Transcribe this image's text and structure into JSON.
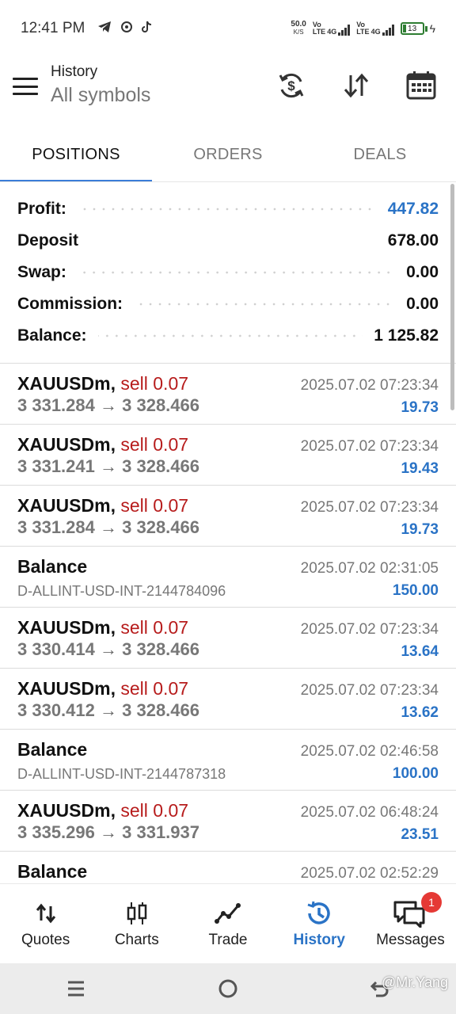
{
  "status_bar": {
    "time": "12:41 PM",
    "net_speed": "50.0",
    "net_unit": "K/S",
    "sim1_label_top": "Vo",
    "sim1_label_bottom": "LTE",
    "sim1_tech": "4G",
    "sim2_label_top": "Vo",
    "sim2_label_bottom": "LTE",
    "sim2_tech": "4G",
    "battery": "13",
    "icons": [
      "telegram-icon",
      "app-icon",
      "tiktok-icon"
    ]
  },
  "header": {
    "title": "History",
    "subtitle": "All symbols",
    "icons": [
      "currency-sync-icon",
      "sort-icon",
      "calendar-icon"
    ]
  },
  "tabs": [
    {
      "label": "POSITIONS",
      "active": true
    },
    {
      "label": "ORDERS",
      "active": false
    },
    {
      "label": "DEALS",
      "active": false
    }
  ],
  "summary": [
    {
      "label": "Profit:",
      "value": "447.82",
      "dots": true,
      "highlight": true
    },
    {
      "label": "Deposit",
      "value": "678.00",
      "dots": false,
      "highlight": false
    },
    {
      "label": "Swap:",
      "value": "0.00",
      "dots": true,
      "highlight": false
    },
    {
      "label": "Commission:",
      "value": "0.00",
      "dots": true,
      "highlight": false
    },
    {
      "label": "Balance:",
      "value": "1 125.82",
      "dots": true,
      "highlight": false
    }
  ],
  "history": [
    {
      "type": "trade",
      "symbol": "XAUUSDm,",
      "side": "sell 0.07",
      "open": "3 331.284",
      "arrow": "→",
      "close": "3 328.466",
      "time": "2025.07.02 07:23:34",
      "profit": "19.73"
    },
    {
      "type": "trade",
      "symbol": "XAUUSDm,",
      "side": "sell 0.07",
      "open": "3 331.241",
      "arrow": "→",
      "close": "3 328.466",
      "time": "2025.07.02 07:23:34",
      "profit": "19.43"
    },
    {
      "type": "trade",
      "symbol": "XAUUSDm,",
      "side": "sell 0.07",
      "open": "3 331.284",
      "arrow": "→",
      "close": "3 328.466",
      "time": "2025.07.02 07:23:34",
      "profit": "19.73"
    },
    {
      "type": "balance",
      "title": "Balance",
      "desc": "D-ALLINT-USD-INT-2144784096",
      "time": "2025.07.02 02:31:05",
      "profit": "150.00"
    },
    {
      "type": "trade",
      "symbol": "XAUUSDm,",
      "side": "sell 0.07",
      "open": "3 330.414",
      "arrow": "→",
      "close": "3 328.466",
      "time": "2025.07.02 07:23:34",
      "profit": "13.64"
    },
    {
      "type": "trade",
      "symbol": "XAUUSDm,",
      "side": "sell 0.07",
      "open": "3 330.412",
      "arrow": "→",
      "close": "3 328.466",
      "time": "2025.07.02 07:23:34",
      "profit": "13.62"
    },
    {
      "type": "balance",
      "title": "Balance",
      "desc": "D-ALLINT-USD-INT-2144787318",
      "time": "2025.07.02 02:46:58",
      "profit": "100.00"
    },
    {
      "type": "trade",
      "symbol": "XAUUSDm,",
      "side": "sell 0.07",
      "open": "3 335.296",
      "arrow": "→",
      "close": "3 331.937",
      "time": "2025.07.02 06:48:24",
      "profit": "23.51"
    },
    {
      "type": "balance",
      "title": "Balance",
      "desc": "",
      "time": "2025.07.02 02:52:29",
      "profit": ""
    }
  ],
  "bottom_nav": [
    {
      "label": "Quotes",
      "icon": "quotes-icon",
      "active": false
    },
    {
      "label": "Charts",
      "icon": "charts-icon",
      "active": false
    },
    {
      "label": "Trade",
      "icon": "trade-icon",
      "active": false
    },
    {
      "label": "History",
      "icon": "history-icon",
      "active": true
    },
    {
      "label": "Messages",
      "icon": "messages-icon",
      "active": false,
      "badge": "1"
    }
  ],
  "watermark": "@Mr.Yang",
  "colors": {
    "accent": "#2a73c6",
    "sell": "#b71c1c",
    "tab_underline": "#3b7dd8",
    "badge": "#e53935"
  }
}
